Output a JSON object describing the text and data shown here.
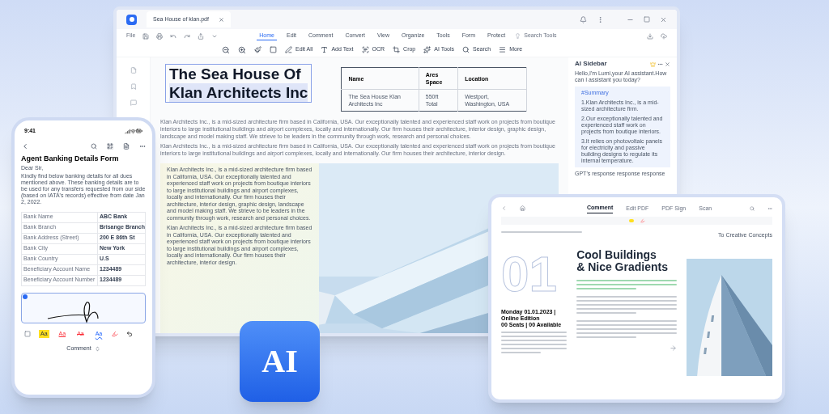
{
  "desktop": {
    "tab_title": "Sea House of klan.pdf",
    "file_menu": "File",
    "menu_tabs": [
      {
        "label": "Home",
        "selected": true
      },
      {
        "label": "Edit",
        "selected": false
      },
      {
        "label": "Comment",
        "selected": false
      },
      {
        "label": "Convert",
        "selected": false
      },
      {
        "label": "View",
        "selected": false
      },
      {
        "label": "Organize",
        "selected": false
      },
      {
        "label": "Tools",
        "selected": false
      },
      {
        "label": "Form",
        "selected": false
      },
      {
        "label": "Protect",
        "selected": false
      }
    ],
    "search": {
      "placeholder": "Search Tools"
    },
    "tools": [
      {
        "kind": "edit",
        "label": "Edit All"
      },
      {
        "kind": "text",
        "label": "Add Text"
      },
      {
        "kind": "ocr",
        "label": "OCR"
      },
      {
        "kind": "crop",
        "label": "Crop"
      },
      {
        "kind": "ai",
        "label": "AI Tools"
      },
      {
        "kind": "search",
        "label": "Search"
      },
      {
        "kind": "more",
        "label": "More"
      }
    ],
    "heading": [
      "The Sea House Of",
      "Klan Architects Inc"
    ],
    "table": {
      "columns": [
        "Name",
        "Ares Space",
        "Location"
      ],
      "rows": [
        [
          "The Sea House Klan Architects Inc",
          "550ft Total",
          "Westport, Washington, USA"
        ]
      ]
    },
    "paragraphs": [
      "Klan Architects Inc., is a mid-sized architecture firm based in California, USA. Our exceptionally talented and experienced staff work on projects from boutique interiors to large institutional buildings and airport complexes, locally and internationally. Our firm houses their architecture, interior design, graphic design, landscape and model making staff. We strieve to be leaders in the community through work, research and personal choices.",
      "Klan Architects Inc., is a mid-sized architecture firm based in California, USA. Our exceptionally talented and experienced staff work on projects from boutique interiors to large institutional buildings and airport complexes, locally and internationally. Our firm houses their architecture, interior design."
    ],
    "column_paragraphs": [
      "Klan Architects Inc., is a mid-sized architecture firm based in California, USA. Our exceptionally talented and experienced staff work on projects from boutique interiors to large institutional buildings and airport complexes, locally and internationally. Our firm houses their architecture, interior design, graphic design, landscape and model making staff. We strieve to be leaders in the community through work, research and personal choices.",
      "Klan Architects Inc., is a mid-sized architecture firm based in California, USA. Our exceptionally talented and experienced staff work on projects from boutique interiors to large institutional buildings and airport complexes, locally and internationally. Our firm houses their architecture, interior design."
    ],
    "ai_sidebar": {
      "title": "AI Sidebar",
      "greeting": "Hello,I'm Lumi,your AI assistant.How can I assistant you today?",
      "summary_title": "#Summary",
      "summary": [
        "1.Klan Architects Inc., is a mid-sized architecture firm.",
        "2.Our exceptionally talented and experienced staff work on projects from boutique interiors.",
        "3.It relies on photovoltaic panels for electricity and passive building designs to regulate its internal temperature."
      ],
      "footer": "GPT's response response response"
    }
  },
  "phone": {
    "time": "9:41",
    "title": "Agent Banking Details Form",
    "salutation": "Dear Sir,",
    "intro": "Kindly find below banking details for all dues mentioned above. These banking details are to be used for any transfers requested from our side (based on IATA's records) effective from date Jan 2, 2022.",
    "rows": [
      [
        "Bank Name",
        "ABC Bank"
      ],
      [
        "Bank Branch",
        "Brisange Branch"
      ],
      [
        "Bank Address (Street)",
        "200 E 86th St"
      ],
      [
        "Bank City",
        "New York"
      ],
      [
        "Bank Country",
        "U.S"
      ],
      [
        "Beneficiary Account Name",
        "1234489"
      ],
      [
        "Beneficiary Account Number",
        "1234489"
      ]
    ],
    "styles": [
      {
        "kind": "highlight",
        "label": "Aa"
      },
      {
        "kind": "underline",
        "label": "Aa"
      },
      {
        "kind": "strike",
        "label": "Aa"
      },
      {
        "kind": "squiggly",
        "label": "Aa"
      }
    ],
    "mode": "Comment"
  },
  "tablet": {
    "tabs": [
      {
        "label": "Comment",
        "selected": true
      },
      {
        "label": "Edit PDF",
        "selected": false
      },
      {
        "label": "PDF Sign",
        "selected": false
      },
      {
        "label": "Scan",
        "selected": false
      }
    ],
    "header_link": "To Creative Concepts",
    "number": "01",
    "title": [
      "Cool Buildings",
      "& Nice Gradients"
    ],
    "edition": "Monday 01.01.2023 | Online Edition",
    "seats": "00 Seats | 00 Available"
  },
  "badge": "AI"
}
